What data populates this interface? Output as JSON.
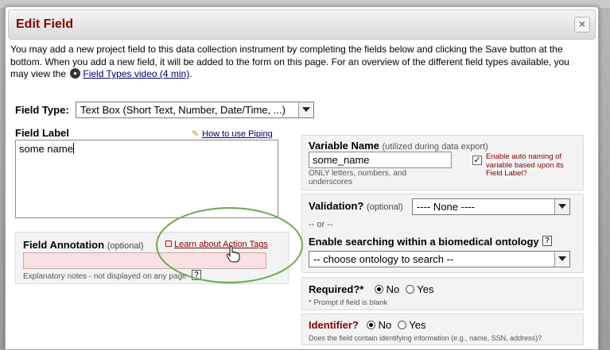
{
  "dialog": {
    "title": "Edit Field",
    "close_label": "×"
  },
  "intro": {
    "text_before_link": "You may add a new project field to this data collection instrument by completing the fields below and clicking the Save button at the bottom. When you add a new field, it will be added to the form on this page. For an overview of the different field types available, you may view the",
    "video_link": "Field Types video (4 min)",
    "text_after_link": "."
  },
  "field_type": {
    "label": "Field Type:",
    "value": "Text Box (Short Text, Number, Date/Time, ...)"
  },
  "field_label": {
    "label": "Field Label",
    "piping_link": "How to use Piping",
    "value": "some name"
  },
  "field_annotation": {
    "label": "Field Annotation",
    "optional": "(optional)",
    "action_tags_link": "Learn about Action Tags",
    "note": "Explanatory notes - not displayed on any page",
    "help": "?"
  },
  "variable_name": {
    "label": "Variable Name",
    "hint": "(utilized during data export)",
    "value": "some_name",
    "note": "ONLY letters, numbers, and underscores",
    "auto_naming_label": "Enable auto naming of variable based upon its Field Label?",
    "auto_naming_checked": true
  },
  "validation": {
    "label": "Validation?",
    "optional": "(optional)",
    "value": "---- None ----",
    "or_text": "-- or --",
    "ontology_label": "Enable searching within a biomedical ontology",
    "ontology_help": "?",
    "ontology_value": "-- choose ontology to search --"
  },
  "required": {
    "label": "Required?*",
    "no": "No",
    "yes": "Yes",
    "selected": "No",
    "note": "* Prompt if field is blank"
  },
  "identifier": {
    "label": "Identifier?",
    "no": "No",
    "yes": "Yes",
    "selected": "No",
    "note": "Does the field contain identifying information (e.g., name, SSN, address)?"
  },
  "colors": {
    "title": "#800000",
    "link": "#000066",
    "highlight_ring": "#6aa84f",
    "annotation_input": "#f9e1e1"
  }
}
